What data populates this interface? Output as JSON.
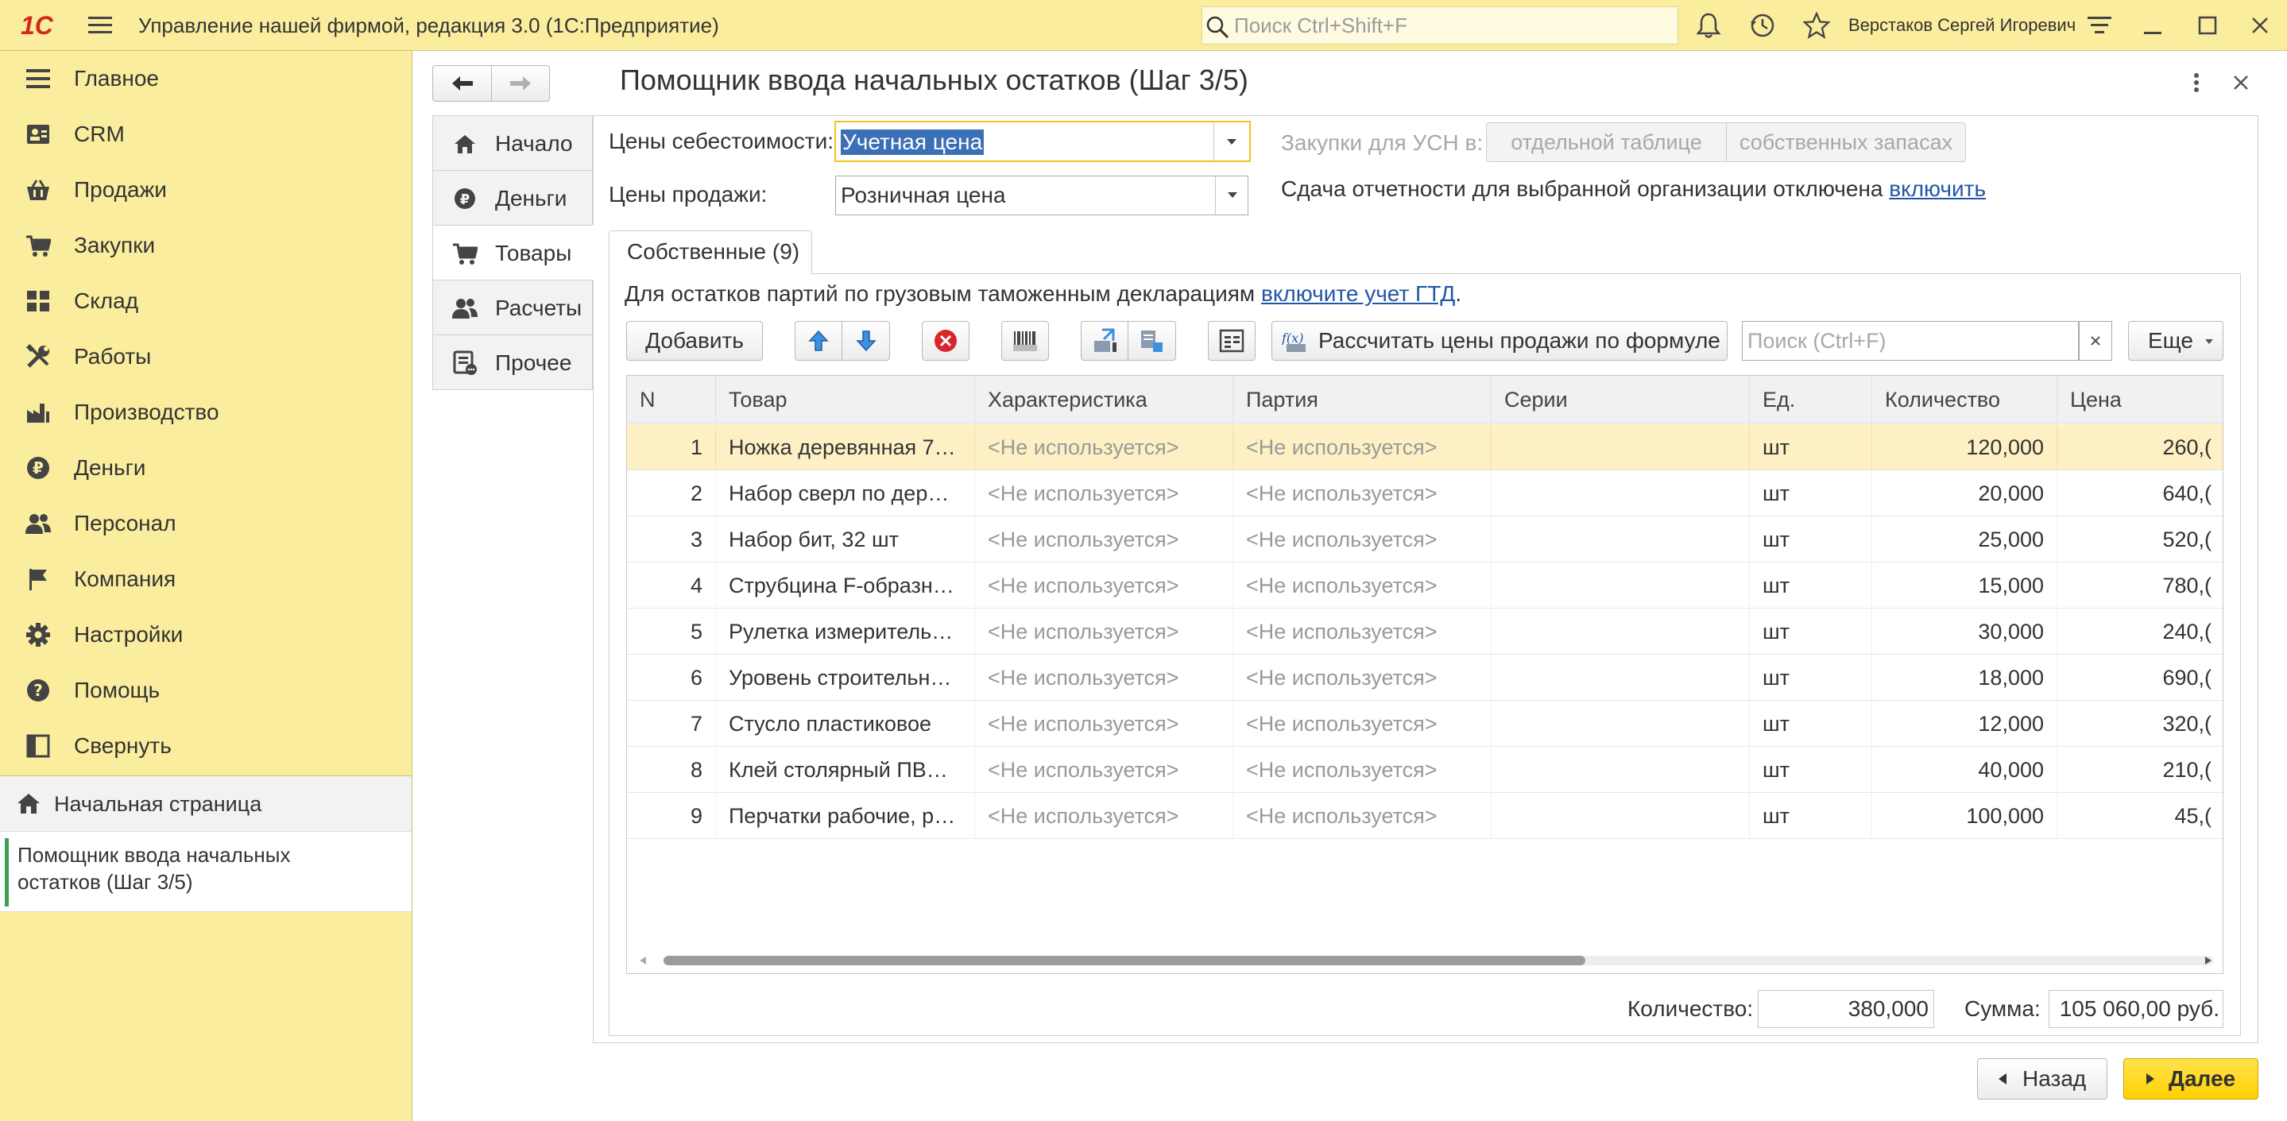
{
  "titlebar": {
    "logo": "1С",
    "title": "Управление нашей фирмой, редакция 3.0  (1С:Предприятие)",
    "search_placeholder": "Поиск Ctrl+Shift+F",
    "user": "Верстаков Сергей Игоревич"
  },
  "sidebar": {
    "items": [
      {
        "label": "Главное",
        "icon": "menu-lines-icon"
      },
      {
        "label": "CRM",
        "icon": "contacts-icon"
      },
      {
        "label": "Продажи",
        "icon": "basket-icon"
      },
      {
        "label": "Закупки",
        "icon": "cart-icon"
      },
      {
        "label": "Склад",
        "icon": "warehouse-icon"
      },
      {
        "label": "Работы",
        "icon": "tools-icon"
      },
      {
        "label": "Производство",
        "icon": "factory-icon"
      },
      {
        "label": "Деньги",
        "icon": "ruble-icon"
      },
      {
        "label": "Персонал",
        "icon": "people-icon"
      },
      {
        "label": "Компания",
        "icon": "flag-icon"
      },
      {
        "label": "Настройки",
        "icon": "gear-icon"
      },
      {
        "label": "Помощь",
        "icon": "help-icon"
      },
      {
        "label": "Свернуть",
        "icon": "collapse-icon"
      }
    ],
    "home": "Начальная страница",
    "open_window_line1": "Помощник ввода начальных",
    "open_window_line2": "остатков (Шаг 3/5)"
  },
  "form": {
    "title": "Помощник ввода начальных остатков (Шаг 3/5)",
    "vtabs": [
      {
        "label": "Начало",
        "icon": "home-icon"
      },
      {
        "label": "Деньги",
        "icon": "ruble-icon"
      },
      {
        "label": "Товары",
        "icon": "cart-icon"
      },
      {
        "label": "Расчеты",
        "icon": "people-icon"
      },
      {
        "label": "Прочее",
        "icon": "document-icon"
      }
    ],
    "cost_price_label": "Цены себестоимости:",
    "cost_price_value": "Учетная цена",
    "sale_price_label": "Цены продажи:",
    "sale_price_value": "Розничная цена",
    "usn_label": "Закупки для УСН в:",
    "usn_option1": "отдельной таблице",
    "usn_option2": "собственных запасах",
    "reporting_text": "Сдача отчетности для выбранной организации отключена",
    "reporting_link": "включить",
    "tab_own": "Собственные (9)",
    "gtd_text": "Для остатков партий по грузовым таможенным декларациям",
    "gtd_link": "включите учет ГТД",
    "gtd_dot": ".",
    "add_button": "Добавить",
    "calc_button": "Рассчитать цены продажи по формуле",
    "table_search_placeholder": "Поиск (Ctrl+F)",
    "more_button": "Еще",
    "columns": [
      "N",
      "Товар",
      "Характеристика",
      "Партия",
      "Серии",
      "Ед.",
      "Количество",
      "Цена"
    ],
    "rows": [
      {
        "n": "1",
        "item": "Ножка деревянная 7…",
        "char": "<Не используется>",
        "batch": "<Не используется>",
        "series": "",
        "unit": "шт",
        "qty": "120,000",
        "price": "260,("
      },
      {
        "n": "2",
        "item": "Набор сверл по дер…",
        "char": "<Не используется>",
        "batch": "<Не используется>",
        "series": "",
        "unit": "шт",
        "qty": "20,000",
        "price": "640,("
      },
      {
        "n": "3",
        "item": "Набор бит, 32 шт",
        "char": "<Не используется>",
        "batch": "<Не используется>",
        "series": "",
        "unit": "шт",
        "qty": "25,000",
        "price": "520,("
      },
      {
        "n": "4",
        "item": "Струбцина F-образн…",
        "char": "<Не используется>",
        "batch": "<Не используется>",
        "series": "",
        "unit": "шт",
        "qty": "15,000",
        "price": "780,("
      },
      {
        "n": "5",
        "item": "Рулетка измеритель…",
        "char": "<Не используется>",
        "batch": "<Не используется>",
        "series": "",
        "unit": "шт",
        "qty": "30,000",
        "price": "240,("
      },
      {
        "n": "6",
        "item": "Уровень строительн…",
        "char": "<Не используется>",
        "batch": "<Не используется>",
        "series": "",
        "unit": "шт",
        "qty": "18,000",
        "price": "690,("
      },
      {
        "n": "7",
        "item": "Стусло пластиковое",
        "char": "<Не используется>",
        "batch": "<Не используется>",
        "series": "",
        "unit": "шт",
        "qty": "12,000",
        "price": "320,("
      },
      {
        "n": "8",
        "item": "Клей столярный ПВ…",
        "char": "<Не используется>",
        "batch": "<Не используется>",
        "series": "",
        "unit": "шт",
        "qty": "40,000",
        "price": "210,("
      },
      {
        "n": "9",
        "item": "Перчатки рабочие, р…",
        "char": "<Не используется>",
        "batch": "<Не используется>",
        "series": "",
        "unit": "шт",
        "qty": "100,000",
        "price": "45,("
      }
    ],
    "qty_label": "Количество:",
    "qty_total": "380,000",
    "sum_label": "Сумма:",
    "sum_total": "105 060,00 руб.",
    "back_button": "Назад",
    "next_button": "Далее"
  },
  "colors": {
    "accent_yellow": "#fbed9e",
    "selected_row": "#fdf0c4",
    "link": "#2356a8",
    "next_button": "#ffd800",
    "sidebar_active_bar": "#3ea055"
  }
}
